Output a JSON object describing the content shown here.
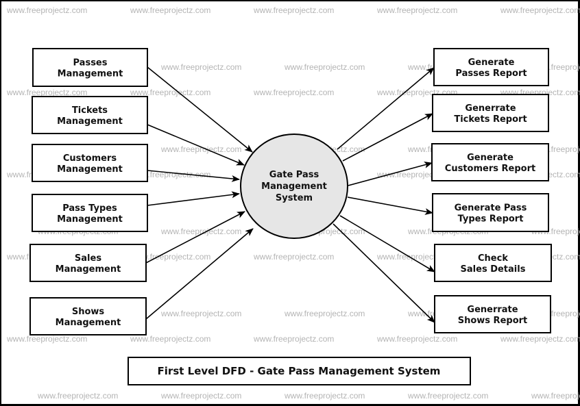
{
  "watermark": "www.freeprojectz.com",
  "process": {
    "label_lines": [
      "Gate Pass",
      "Management",
      "System"
    ],
    "fill": "#e6e6e6"
  },
  "inputs": [
    {
      "id": "passes-management",
      "lines": [
        "Passes",
        "Management"
      ]
    },
    {
      "id": "tickets-management",
      "lines": [
        "Tickets",
        "Management"
      ]
    },
    {
      "id": "customers-management",
      "lines": [
        "Customers",
        "Management"
      ]
    },
    {
      "id": "pass-types-management",
      "lines": [
        "Pass Types",
        "Management"
      ]
    },
    {
      "id": "sales-management",
      "lines": [
        "Sales",
        "Management"
      ]
    },
    {
      "id": "shows-management",
      "lines": [
        "Shows",
        "Management"
      ]
    }
  ],
  "outputs": [
    {
      "id": "generate-passes-report",
      "lines": [
        "Generate",
        "Passes Report"
      ]
    },
    {
      "id": "generrate-tickets-report",
      "lines": [
        "Generrate",
        "Tickets Report"
      ]
    },
    {
      "id": "generate-customers-report",
      "lines": [
        "Generate",
        "Customers Report"
      ]
    },
    {
      "id": "generate-pass-types-report",
      "lines": [
        "Generate Pass",
        "Types Report"
      ]
    },
    {
      "id": "check-sales-details",
      "lines": [
        "Check",
        "Sales Details"
      ]
    },
    {
      "id": "generrate-shows-report",
      "lines": [
        "Generrate",
        "Shows Report"
      ]
    }
  ],
  "title": "First Level DFD - Gate Pass Management System"
}
